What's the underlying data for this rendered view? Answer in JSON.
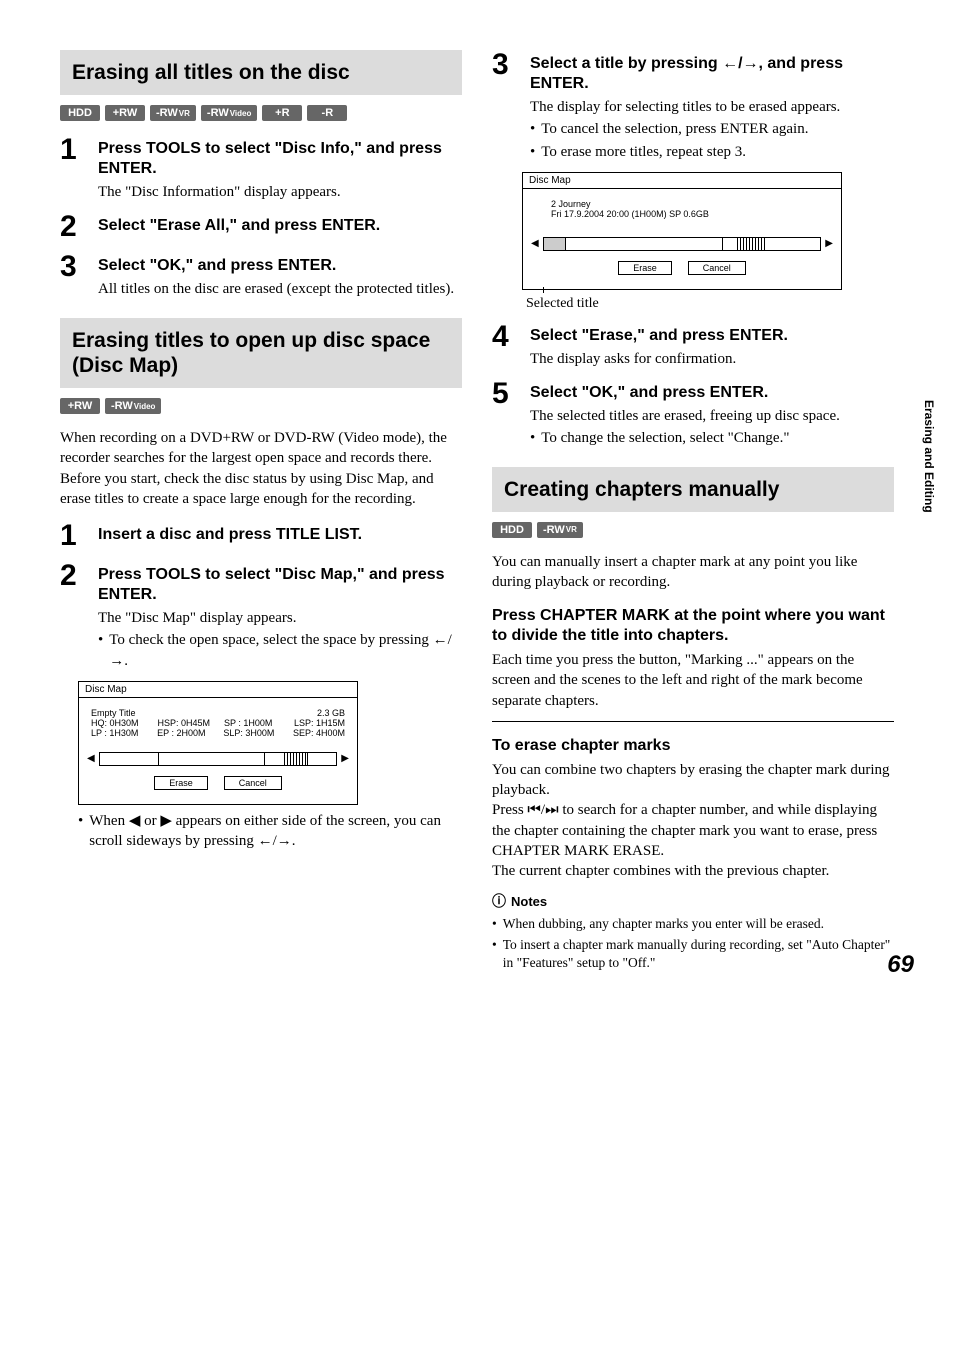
{
  "sideTab": "Erasing and Editing",
  "pageNumber": "69",
  "left": {
    "sectionA": {
      "heading": "Erasing all titles on the disc",
      "badges": [
        "HDD",
        "+RW",
        "-RWVR",
        "-RWVideo",
        "+R",
        "-R"
      ],
      "steps": [
        {
          "num": "1",
          "title": "Press TOOLS to select \"Disc Info,\" and press ENTER.",
          "text": "The \"Disc Information\" display appears."
        },
        {
          "num": "2",
          "title": "Select \"Erase All,\" and press ENTER.",
          "text": ""
        },
        {
          "num": "3",
          "title": "Select \"OK,\" and press ENTER.",
          "text": "All titles on the disc are erased (except the protected titles)."
        }
      ]
    },
    "sectionB": {
      "heading": "Erasing titles to open up disc space (Disc Map)",
      "badges": [
        "+RW",
        "-RWVideo"
      ],
      "intro": "When recording on a DVD+RW or DVD-RW (Video mode), the recorder searches for the largest open space and records there. Before you start, check the disc status by using Disc Map, and erase titles to create a space large enough for the recording.",
      "steps": [
        {
          "num": "1",
          "title": "Insert a disc and press TITLE LIST.",
          "text": ""
        },
        {
          "num": "2",
          "title": "Press TOOLS to select \"Disc Map,\" and press ENTER.",
          "text": "The \"Disc Map\" display appears.",
          "bullet": "To check the open space, select the space by pressing ←/→."
        }
      ],
      "afterMockBullet": "When ◀ or ▶ appears on either side of the screen, you can scroll sideways by pressing ←/→."
    },
    "mock1": {
      "title": "Disc Map",
      "rows": [
        [
          "Empty Title",
          "",
          "",
          "2.3 GB"
        ],
        [
          "HQ: 0H30M",
          "HSP: 0H45M",
          "SP : 1H00M",
          "LSP: 1H15M"
        ],
        [
          "LP : 1H30M",
          "EP : 2H00M",
          "SLP: 3H00M",
          "SEP: 4H00M"
        ]
      ],
      "btns": [
        "Erase",
        "Cancel"
      ]
    }
  },
  "right": {
    "step3": {
      "num": "3",
      "title": "Select a title by pressing ←/→, and press ENTER.",
      "text": "The display for selecting titles to be erased appears.",
      "bullets": [
        "To cancel the selection, press ENTER again.",
        "To erase more titles, repeat step 3."
      ]
    },
    "mock2": {
      "title": "Disc Map",
      "line1": "2 Journey",
      "line2": "Fri  17.9.2004  20:00 (1H00M)     SP   0.6GB",
      "btns": [
        "Erase",
        "Cancel"
      ],
      "caption": "Selected title"
    },
    "step4": {
      "num": "4",
      "title": "Select \"Erase,\" and press ENTER.",
      "text": "The display asks for confirmation."
    },
    "step5": {
      "num": "5",
      "title": "Select \"OK,\" and press ENTER.",
      "text": "The selected titles are erased, freeing up disc space.",
      "bullet": "To change the selection, select \"Change.\""
    },
    "sectionC": {
      "heading": "Creating chapters manually",
      "badges": [
        "HDD",
        "-RWVR"
      ],
      "intro": "You can manually insert a chapter mark at any point you like during playback or recording.",
      "sub1": {
        "title": "Press CHAPTER MARK at the point where you want to divide the title into chapters.",
        "text": "Each time you press the button, \"Marking ...\" appears on the screen and the scenes to the left and right of the mark become separate chapters."
      },
      "sub2": {
        "title": "To erase chapter marks",
        "text1": "You can combine two chapters by erasing the chapter mark during playback.",
        "text2": "Press ⏮/⏭ to search for a chapter number, and while displaying the chapter containing the chapter mark you want to erase, press CHAPTER MARK ERASE.",
        "text3": "The current chapter combines with the previous chapter."
      },
      "notesTitle": "Notes",
      "notes": [
        "When dubbing, any chapter marks you enter will be erased.",
        "To insert a chapter mark manually during recording, set \"Auto Chapter\" in \"Features\" setup to \"Off.\""
      ]
    }
  }
}
